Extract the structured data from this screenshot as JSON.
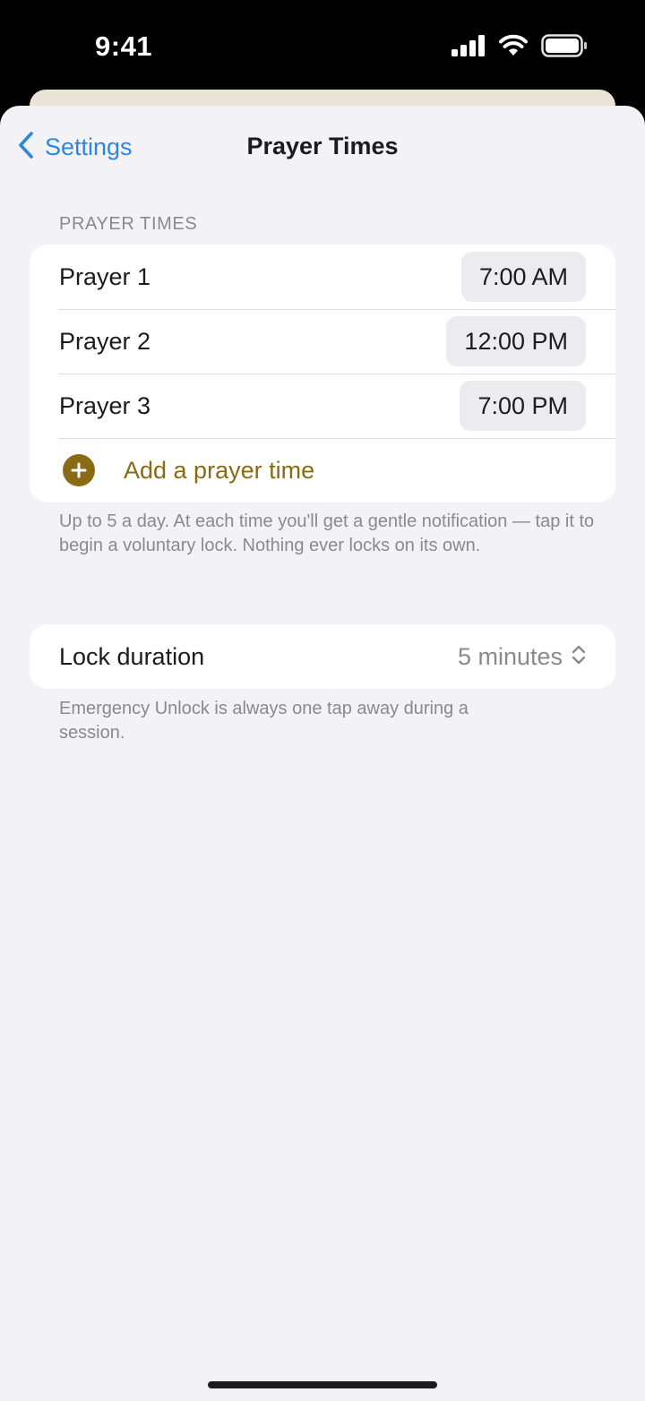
{
  "status_bar": {
    "time": "9:41",
    "icons": [
      "cellular-signal-icon",
      "wifi-icon",
      "battery-icon"
    ]
  },
  "nav": {
    "back_label": "Settings",
    "title": "Prayer Times"
  },
  "prayer_section": {
    "header": "PRAYER TIMES",
    "rows": [
      {
        "label": "Prayer 1",
        "time": "7:00 AM"
      },
      {
        "label": "Prayer 2",
        "time": "12:00 PM"
      },
      {
        "label": "Prayer 3",
        "time": "7:00 PM"
      }
    ],
    "add_label": "Add a prayer time",
    "footnote": "Up to 5 a day. At each time you'll get a gentle notification — tap it to begin a voluntary lock. Nothing ever locks on its own."
  },
  "duration_section": {
    "label": "Lock duration",
    "value": "5 minutes",
    "footnote": "Emergency Unlock is always one tap away during a session."
  },
  "colors": {
    "accent_blue": "#2f86e0",
    "accent_gold": "#8a6a14",
    "background": "#f2f2f7"
  }
}
